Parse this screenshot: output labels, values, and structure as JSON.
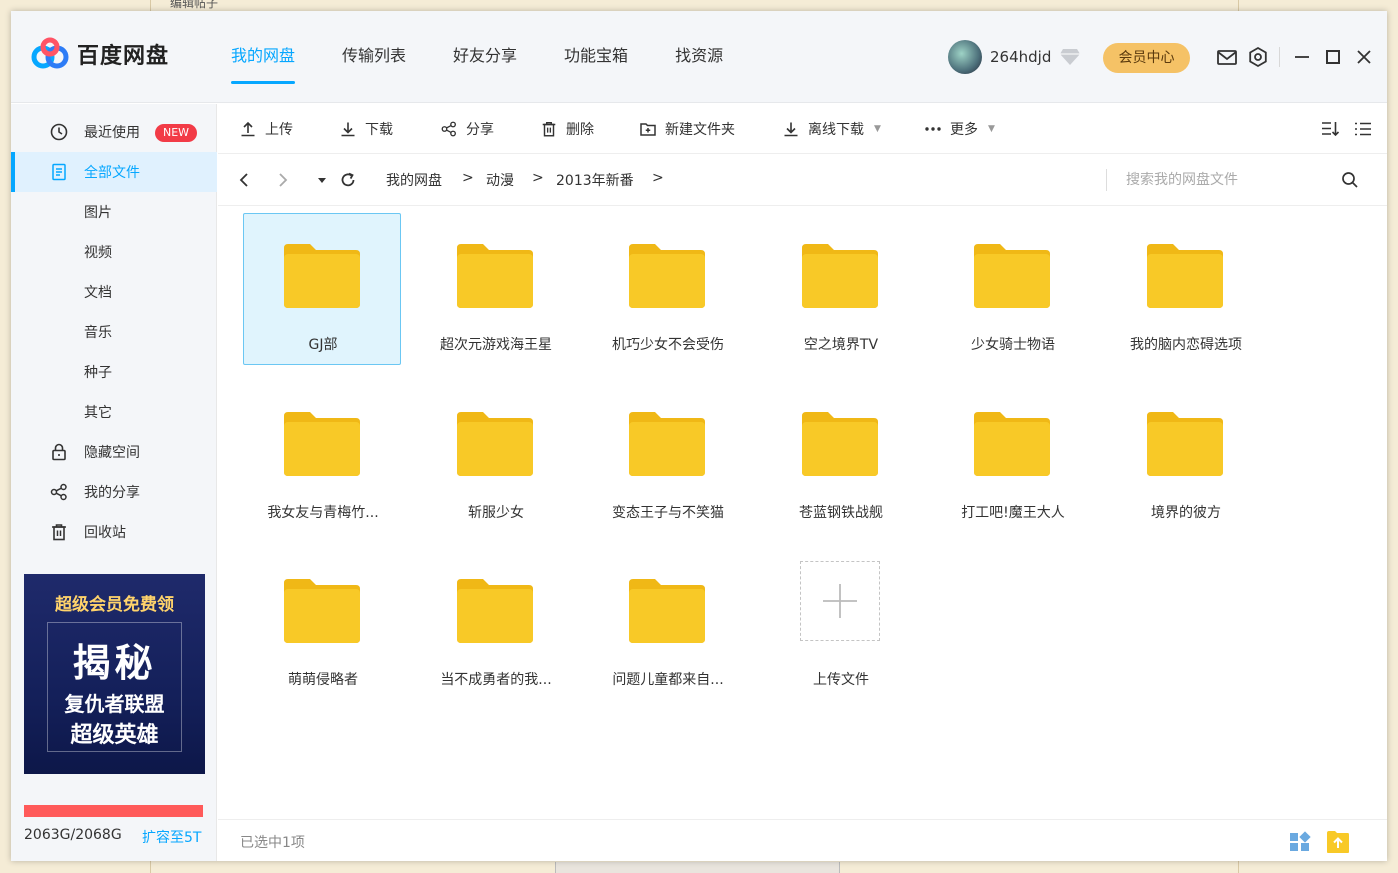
{
  "background": {
    "post_title_fragment": "编辑帖子"
  },
  "app": {
    "name": "百度网盘"
  },
  "nav": {
    "tabs": [
      {
        "label": "我的网盘",
        "active": true
      },
      {
        "label": "传输列表",
        "active": false
      },
      {
        "label": "好友分享",
        "active": false
      },
      {
        "label": "功能宝箱",
        "active": false
      },
      {
        "label": "找资源",
        "active": false
      }
    ]
  },
  "user": {
    "name": "264hdjd",
    "member_button": "会员中心"
  },
  "sidebar": {
    "items": [
      {
        "label": "最近使用",
        "icon": "clock-icon",
        "badge": "NEW"
      },
      {
        "label": "全部文件",
        "icon": "file-icon",
        "active": true
      },
      {
        "label": "图片"
      },
      {
        "label": "视频"
      },
      {
        "label": "文档"
      },
      {
        "label": "音乐"
      },
      {
        "label": "种子"
      },
      {
        "label": "其它"
      },
      {
        "label": "隐藏空间",
        "icon": "lock-icon"
      },
      {
        "label": "我的分享",
        "icon": "share-icon"
      },
      {
        "label": "回收站",
        "icon": "trash-icon"
      }
    ],
    "ad": {
      "line1": "超级会员免费领",
      "line2": "揭秘",
      "line3": "复仇者联盟",
      "line4": "超级英雄"
    },
    "quota": {
      "used": "2063G/2068G",
      "used_fraction": 0.998,
      "expand_link": "扩容至5T"
    }
  },
  "toolbar": {
    "upload": "上传",
    "download": "下载",
    "share": "分享",
    "delete": "删除",
    "new_folder": "新建文件夹",
    "offline_download": "离线下载",
    "more": "更多"
  },
  "breadcrumb": {
    "items": [
      "我的网盘",
      "动漫",
      "2013年新番"
    ],
    "separator": ">"
  },
  "search": {
    "placeholder": "搜索我的网盘文件"
  },
  "files": [
    {
      "name": "GJ部",
      "selected": true
    },
    {
      "name": "超次元游戏海王星"
    },
    {
      "name": "机巧少女不会受伤"
    },
    {
      "name": "空之境界TV"
    },
    {
      "name": "少女骑士物语"
    },
    {
      "name": "我的脑内恋碍选项"
    },
    {
      "name": "我女友与青梅竹..."
    },
    {
      "name": "斩服少女"
    },
    {
      "name": "变态王子与不笑猫"
    },
    {
      "name": "苍蓝钢铁战舰"
    },
    {
      "name": "打工吧!魔王大人"
    },
    {
      "name": "境界的彼方"
    },
    {
      "name": "萌萌侵略者"
    },
    {
      "name": "当不成勇者的我..."
    },
    {
      "name": "问题儿童都来自..."
    }
  ],
  "upload_tile": {
    "label": "上传文件"
  },
  "status": {
    "text": "已选中1项"
  },
  "colors": {
    "accent": "#06a7ff",
    "folder": "#f8c927",
    "folder_tab": "#f0b816",
    "selected_bg": "#e0f4fd"
  }
}
